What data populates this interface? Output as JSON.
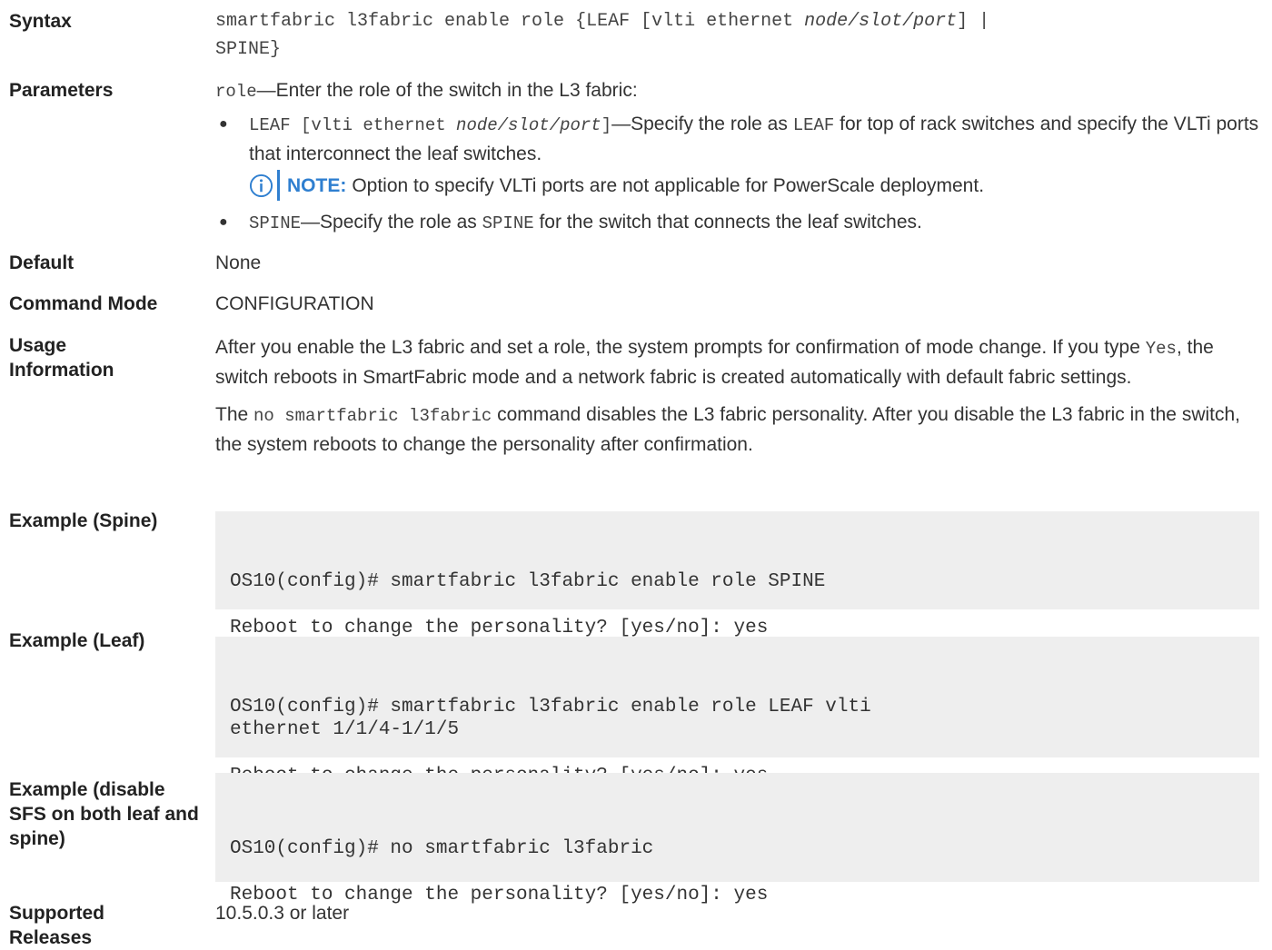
{
  "syntax": {
    "label": "Syntax",
    "text_part1": "smartfabric l3fabric enable role {LEAF [vlti ethernet ",
    "text_italic": "node/slot/port",
    "text_part2": "] |",
    "text_line2": "SPINE}"
  },
  "parameters": {
    "label": "Parameters",
    "intro_mono": "role",
    "intro_text": "—Enter the role of the switch in the L3 fabric:",
    "bullets": [
      {
        "mono_prefix": "LEAF [vlti ethernet ",
        "mono_italic": "node/slot/port",
        "mono_suffix": "]",
        "text_a": "—Specify the role as ",
        "mono_b": "LEAF",
        "text_c": " for top of rack switches and specify the VLTi ports that interconnect the leaf switches."
      },
      {
        "mono_prefix": "SPINE",
        "text_a": "—Specify the role as ",
        "mono_b": "SPINE",
        "text_c": " for the switch that connects the leaf switches."
      }
    ],
    "note_label": "NOTE:",
    "note_text": "Option to specify VLTi ports are not applicable for PowerScale deployment."
  },
  "default": {
    "label": "Default",
    "value": "None"
  },
  "command_mode": {
    "label": "Command Mode",
    "value": "CONFIGURATION"
  },
  "usage": {
    "label": "Usage Information",
    "p1_a": "After you enable the L3 fabric and set a role, the system prompts for confirmation of mode change. If you type ",
    "p1_mono": "Yes",
    "p1_b": ", the switch reboots in SmartFabric mode and a network fabric is created automatically with default fabric settings.",
    "p2_a": "The ",
    "p2_mono": "no smartfabric l3fabric",
    "p2_b": " command disables the L3 fabric personality. After you disable the L3 fabric in the switch, the system reboots to change the personality after confirmation."
  },
  "example_spine": {
    "label": "Example (Spine)",
    "line1": "OS10(config)# smartfabric l3fabric enable role SPINE",
    "line2": "Reboot to change the personality? [yes/no]: yes"
  },
  "example_leaf": {
    "label": "Example (Leaf)",
    "line1": "OS10(config)# smartfabric l3fabric enable role LEAF vlti",
    "line1b": "ethernet 1/1/4-1/1/5",
    "line2": "Reboot to change the personality? [yes/no]: yes"
  },
  "example_disable": {
    "label": "Example (disable SFS on both leaf and spine)",
    "line1": "OS10(config)# no smartfabric l3fabric",
    "line2": "Reboot to change the personality? [yes/no]: yes"
  },
  "supported_releases": {
    "label": "Supported Releases",
    "value": "10.5.0.3 or later"
  },
  "colors": {
    "note_accent": "#2f7fd0",
    "code_background": "#eeeeee"
  },
  "icons": {
    "note": "info-circle-icon"
  }
}
